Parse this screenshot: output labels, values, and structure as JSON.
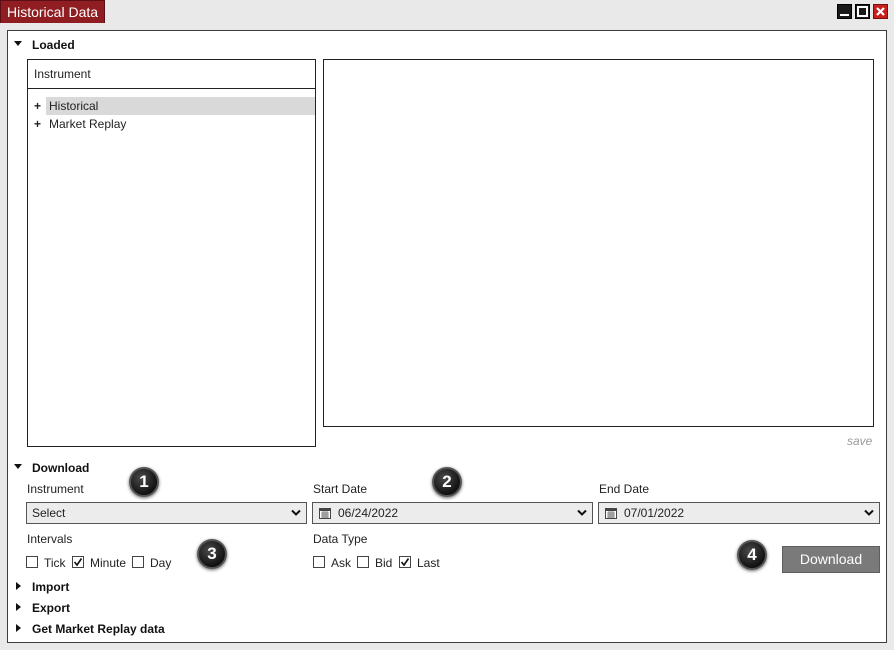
{
  "window": {
    "title": "Historical Data"
  },
  "loaded": {
    "header": "Loaded",
    "tree_column": "Instrument",
    "tree_items": [
      {
        "label": "Historical",
        "selected": true
      },
      {
        "label": "Market Replay",
        "selected": false
      }
    ],
    "save_label": "save"
  },
  "download": {
    "header": "Download",
    "instrument_label": "Instrument",
    "instrument_value": "Select",
    "start_date_label": "Start Date",
    "start_date_value": "06/24/2022",
    "end_date_label": "End Date",
    "end_date_value": "07/01/2022",
    "intervals_label": "Intervals",
    "intervals": [
      {
        "label": "Tick",
        "checked": false
      },
      {
        "label": "Minute",
        "checked": true
      },
      {
        "label": "Day",
        "checked": false
      }
    ],
    "data_type_label": "Data Type",
    "data_types": [
      {
        "label": "Ask",
        "checked": false
      },
      {
        "label": "Bid",
        "checked": false
      },
      {
        "label": "Last",
        "checked": true
      }
    ],
    "button_label": "Download"
  },
  "markers": [
    "1",
    "2",
    "3",
    "4"
  ],
  "collapsed_sections": [
    "Import",
    "Export",
    "Get Market Replay data"
  ],
  "colors": {
    "title_tab": "#8f1d21",
    "close_button": "#c81e1e",
    "download_button": "#7a7a7a",
    "selected_row": "#d9d9d9"
  }
}
